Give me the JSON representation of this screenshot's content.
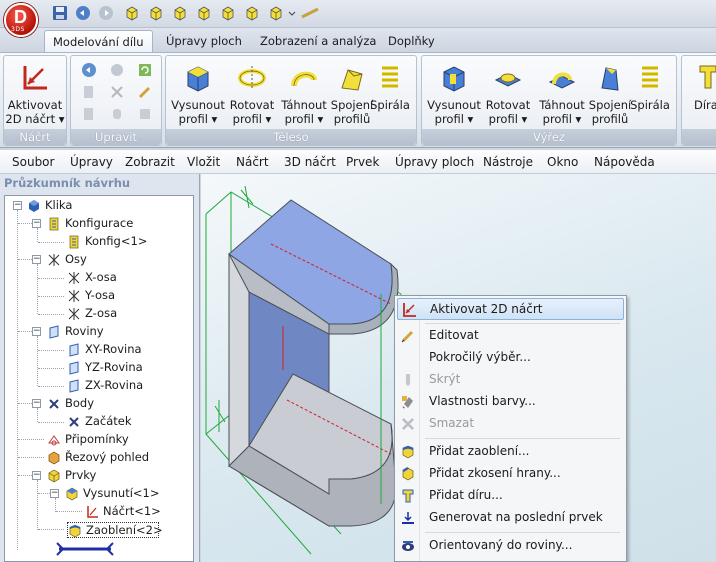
{
  "app": {
    "logo_letter": "D",
    "logo_sub": "3DS"
  },
  "ribbon_tabs": [
    {
      "label": "Modelování dílu",
      "active": true
    },
    {
      "label": "Úpravy ploch",
      "active": false
    },
    {
      "label": "Zobrazení a analýza",
      "active": false
    },
    {
      "label": "Doplňky",
      "active": false
    }
  ],
  "ribbon": {
    "groups": {
      "nacrt": "Náčrt",
      "upravit": "Upravit",
      "teleso": "Těleso",
      "vyrez": "Výřez"
    },
    "activate_sketch": {
      "line1": "Aktivovat",
      "line2": "2D náčrt ▾"
    },
    "teleso_buttons": [
      {
        "line1": "Vysunout",
        "line2": "profil ▾"
      },
      {
        "line1": "Rotovat",
        "line2": "profil ▾"
      },
      {
        "line1": "Táhnout",
        "line2": "profil ▾"
      },
      {
        "line1": "Spojení",
        "line2": "profilů"
      },
      {
        "line1": "Spirála",
        "line2": ""
      }
    ],
    "vyrez_buttons": [
      {
        "line1": "Vysunout",
        "line2": "profil ▾"
      },
      {
        "line1": "Rotovat",
        "line2": "profil ▾"
      },
      {
        "line1": "Táhnout",
        "line2": "profil ▾"
      },
      {
        "line1": "Spojení",
        "line2": "profilů"
      },
      {
        "line1": "Spirála",
        "line2": ""
      }
    ],
    "cut_off_button": "Díra"
  },
  "menubar": [
    "Soubor",
    "Úpravy",
    "Zobrazit",
    "Vložit",
    "Náčrt",
    "3D náčrt",
    "Prvek",
    "Úpravy ploch",
    "Nástroje",
    "Okno",
    "Nápověda"
  ],
  "explorer": {
    "title": "Průzkumník návrhu",
    "tree": [
      {
        "label": "Klika",
        "level": 0,
        "icon": "part-icon"
      },
      {
        "label": "Konfigurace",
        "level": 1,
        "icon": "configuration-icon"
      },
      {
        "label": "Konfig<1>",
        "level": 2,
        "icon": "configuration-icon"
      },
      {
        "label": "Osy",
        "level": 1,
        "icon": "axis-icon"
      },
      {
        "label": "X-osa",
        "level": 2,
        "icon": "axis-icon"
      },
      {
        "label": "Y-osa",
        "level": 2,
        "icon": "axis-icon"
      },
      {
        "label": "Z-osa",
        "level": 2,
        "icon": "axis-icon"
      },
      {
        "label": "Roviny",
        "level": 1,
        "icon": "plane-icon"
      },
      {
        "label": "XY-Rovina",
        "level": 2,
        "icon": "plane-icon"
      },
      {
        "label": "YZ-Rovina",
        "level": 2,
        "icon": "plane-icon"
      },
      {
        "label": "ZX-Rovina",
        "level": 2,
        "icon": "plane-icon"
      },
      {
        "label": "Body",
        "level": 1,
        "icon": "point-icon"
      },
      {
        "label": "Začátek",
        "level": 2,
        "icon": "point-icon"
      },
      {
        "label": "Připomínky",
        "level": 1,
        "icon": "annotation-icon"
      },
      {
        "label": "Řezový pohled",
        "level": 1,
        "icon": "section-view-icon"
      },
      {
        "label": "Prvky",
        "level": 1,
        "icon": "features-icon"
      },
      {
        "label": "Vysunutí<1>",
        "level": 2,
        "icon": "extrude-icon"
      },
      {
        "label": "Náčrt<1>",
        "level": 3,
        "icon": "sketch-icon"
      },
      {
        "label": "Zaoblení<2>",
        "level": 2,
        "icon": "fillet-icon"
      }
    ]
  },
  "context_menu": [
    {
      "label": "Aktivovat 2D náčrt",
      "icon": "sketch-icon",
      "state": "hover"
    },
    {
      "label": "Editovat",
      "icon": "edit-icon",
      "state": "normal"
    },
    {
      "label": "Pokročilý výběr...",
      "icon": "",
      "state": "normal"
    },
    {
      "label": "Skrýt",
      "icon": "hide-icon",
      "state": "disabled"
    },
    {
      "label": "Vlastnosti barvy...",
      "icon": "color-icon",
      "state": "normal"
    },
    {
      "label": "Smazat",
      "icon": "delete-icon",
      "state": "disabled"
    },
    {
      "label": "Přidat zaoblení...",
      "icon": "fillet-icon",
      "state": "normal"
    },
    {
      "label": "Přidat zkosení hrany...",
      "icon": "chamfer-icon",
      "state": "normal"
    },
    {
      "label": "Přidat díru...",
      "icon": "hole-icon",
      "state": "normal"
    },
    {
      "label": "Generovat na poslední prvek",
      "icon": "rollback-icon",
      "state": "normal"
    },
    {
      "label": "Orientovaný do roviny...",
      "icon": "orient-icon",
      "state": "normal"
    }
  ],
  "colors": {
    "accent": "#2a6fb8",
    "model_face_top": "#8fa6e6",
    "model_face_side": "#c9cdd3",
    "sketch_lines": "#21a83a",
    "logo": "#d81e12"
  }
}
